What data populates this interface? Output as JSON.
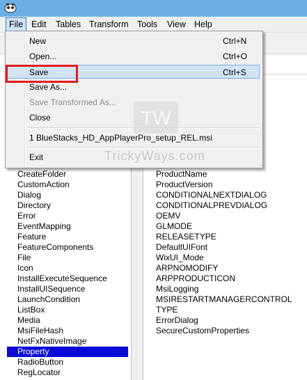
{
  "menubar": {
    "items": [
      "File",
      "Edit",
      "Tables",
      "Transform",
      "Tools",
      "View",
      "Help"
    ]
  },
  "file_menu": {
    "new": {
      "label": "New",
      "shortcut": "Ctrl+N"
    },
    "open": {
      "label": "Open...",
      "shortcut": "Ctrl+O"
    },
    "save": {
      "label": "Save",
      "shortcut": "Ctrl+S"
    },
    "save_as": {
      "label": "Save As..."
    },
    "save_transformed": {
      "label": "Save Transformed As..."
    },
    "close": {
      "label": "Close"
    },
    "recent": {
      "label": "1 BlueStacks_HD_AppPlayerPro_setup_REL.msi"
    },
    "exit": {
      "label": "Exit"
    }
  },
  "watermark": {
    "logo": "TW",
    "text": "TrickyWays.com"
  },
  "tables": [
    "CreateFolder",
    "CustomAction",
    "Dialog",
    "Directory",
    "Error",
    "EventMapping",
    "Feature",
    "FeatureComponents",
    "File",
    "Icon",
    "InstallExecuteSequence",
    "InstallUISequence",
    "LaunchCondition",
    "ListBox",
    "Media",
    "MsiFileHash",
    "NetFxNativeImage",
    "Property",
    "RadioButton",
    "RegLocator"
  ],
  "selected_table": "Property",
  "properties": [
    "ProductName",
    "ProductVersion",
    "CONDITIONALNEXTDIALOG",
    "CONDITIONALPREVDIALOG",
    "OEMV",
    "GLMODE",
    "RELEASETYPE",
    "DefaultUIFont",
    "WixUI_Mode",
    "ARPNOMODIFY",
    "ARPPRODUCTICON",
    "MsiLogging",
    "MSIRESTARTMANAGERCONTROL",
    "TYPE",
    "ErrorDialog",
    "SecureCustomProperties"
  ],
  "colors": {
    "highlight": "#e21b1b",
    "selection": "#0a0ad8",
    "titlebar": "#6ab0e6"
  }
}
